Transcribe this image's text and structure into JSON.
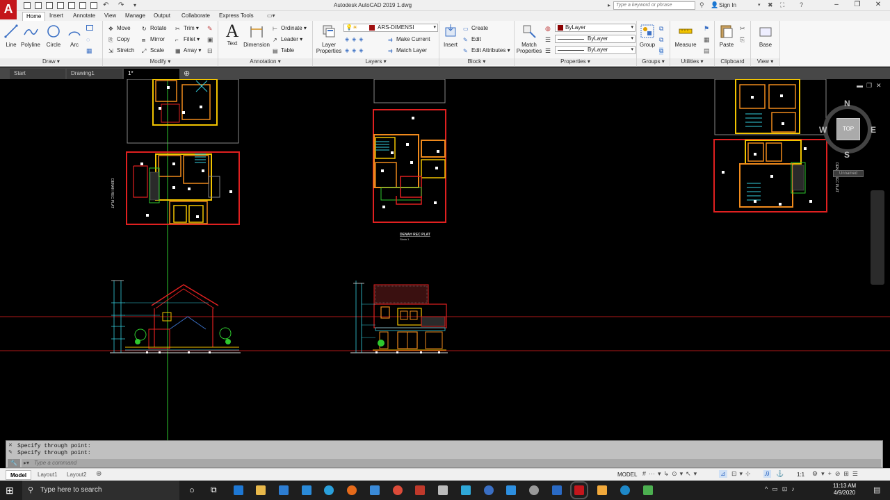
{
  "app": {
    "logo": "A",
    "window_title": "Autodesk AutoCAD 2019    1.dwg",
    "search_placeholder": "Type a keyword or phrase",
    "sign_in": "Sign In"
  },
  "ribbon_tabs": [
    "Home",
    "Insert",
    "Annotate",
    "View",
    "Manage",
    "Output",
    "Collaborate",
    "Express Tools"
  ],
  "draw": {
    "title": "Draw",
    "line": "Line",
    "polyline": "Polyline",
    "circle": "Circle",
    "arc": "Arc"
  },
  "modify": {
    "title": "Modify",
    "move": "Move",
    "rotate": "Rotate",
    "trim": "Trim",
    "copy": "Copy",
    "mirror": "Mirror",
    "fillet": "Fillet",
    "stretch": "Stretch",
    "scale": "Scale",
    "array": "Array"
  },
  "annotation": {
    "title": "Annotation",
    "text": "Text",
    "dimension": "Dimension",
    "ordinate": "Ordinate",
    "leader": "Leader",
    "table": "Table"
  },
  "layers": {
    "title": "Layers",
    "layer_properties": "Layer Properties",
    "current_layer": "ARS-DIMENSI",
    "make_current": "Make Current",
    "match_layer": "Match Layer"
  },
  "block": {
    "title": "Block",
    "insert": "Insert",
    "create": "Create",
    "edit": "Edit",
    "edit_attributes": "Edit Attributes"
  },
  "properties": {
    "title": "Properties",
    "match_properties": "Match Properties",
    "color": "ByLayer",
    "linetype": "ByLayer",
    "lineweight": "ByLayer"
  },
  "groups": {
    "title": "Groups",
    "group": "Group"
  },
  "utilities": {
    "title": "Utilities",
    "measure": "Measure"
  },
  "clipboard": {
    "title": "Clipboard",
    "paste": "Paste"
  },
  "view_panel": {
    "title": "View",
    "base": "Base"
  },
  "doc_tabs": [
    "Start",
    "Drawing1",
    "1*"
  ],
  "drawing": {
    "plan_label": "DENAH REC PLAT",
    "plan_scale": "Skala 1",
    "side_label": "DENAH REC PLAT",
    "viewcube": {
      "n": "N",
      "s": "S",
      "e": "E",
      "w": "W",
      "face": "TOP",
      "ucs": "Unnamed"
    }
  },
  "command": {
    "history": [
      "Specify through point:",
      "Specify through point:"
    ],
    "placeholder": "Type a command"
  },
  "layout_tabs": [
    "Model",
    "Layout1",
    "Layout2"
  ],
  "status": {
    "mode": "MODEL",
    "scale": "1:1"
  },
  "taskbar": {
    "search": "Type here to search",
    "time": "11:13 AM",
    "date": "4/9/2020"
  },
  "colors": {
    "wall_red": "#e02020",
    "wall_yellow": "#f2c400",
    "wall_orange": "#f08a1c",
    "cyan": "#35d0e0",
    "green": "#2ec82e",
    "magenta": "#d040d0",
    "autocad_red": "#c4161c"
  }
}
